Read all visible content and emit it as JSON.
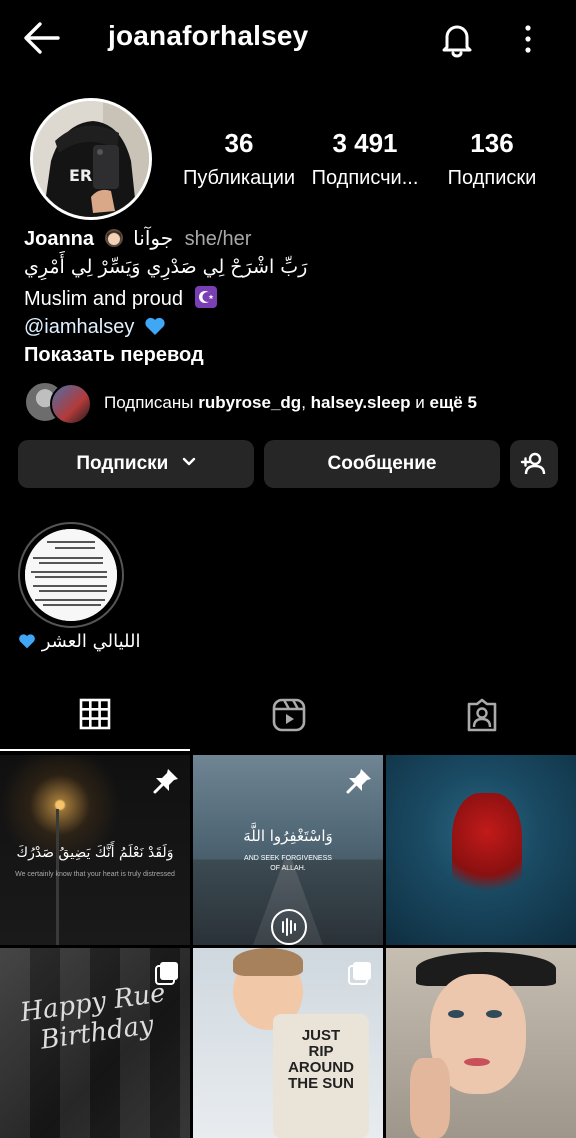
{
  "header": {
    "username": "joanaforhalsey"
  },
  "stats": [
    {
      "num": "36",
      "label": "Публикации"
    },
    {
      "num": "3 491",
      "label": "Подписчи..."
    },
    {
      "num": "136",
      "label": "Подписки"
    }
  ],
  "bio": {
    "name": "Joanna",
    "name_arabic": "جوآنا",
    "pronouns": "she/her",
    "arabic_line": "رَبِّ اشْرَحْ لِي صَدْرِي وَيَسِّرْ لِي أَمْرِي",
    "muslim_line": "Muslim and proud",
    "mention": "@iamhalsey",
    "show_translation": "Показать перевод"
  },
  "followed_by": {
    "prefix": "Подписаны",
    "user1": "rubyrose_dg",
    "sep": ",",
    "user2": "halsey.sleep",
    "and": "и",
    "more": "ещё 5"
  },
  "buttons": {
    "following": "Подписки",
    "message": "Сообщение"
  },
  "highlight": {
    "label": "الليالي العشر"
  },
  "posts": [
    {
      "caption_ar": "وَلَقَدْ نَعْلَمُ أَنَّكَ يَضِيقُ صَدْرُكَ",
      "caption_en": "We certainly know that your heart is truly distressed"
    },
    {
      "caption_ar": "وَاسْتَغْفِرُوا اللَّهَ",
      "caption_en1": "AND SEEK FORGIVENESS",
      "caption_en2": "OF ALLAH."
    },
    {},
    {
      "caption": "Happy Rue Birthday"
    },
    {
      "cake1": "JUST",
      "cake2": "RIP",
      "cake3": "AROUND",
      "cake4": "THE SUN"
    },
    {}
  ],
  "colors": {
    "background": "#000000",
    "button_bg": "#262626",
    "muted_text": "#a8a8a8",
    "mention": "#e0f1ff"
  }
}
